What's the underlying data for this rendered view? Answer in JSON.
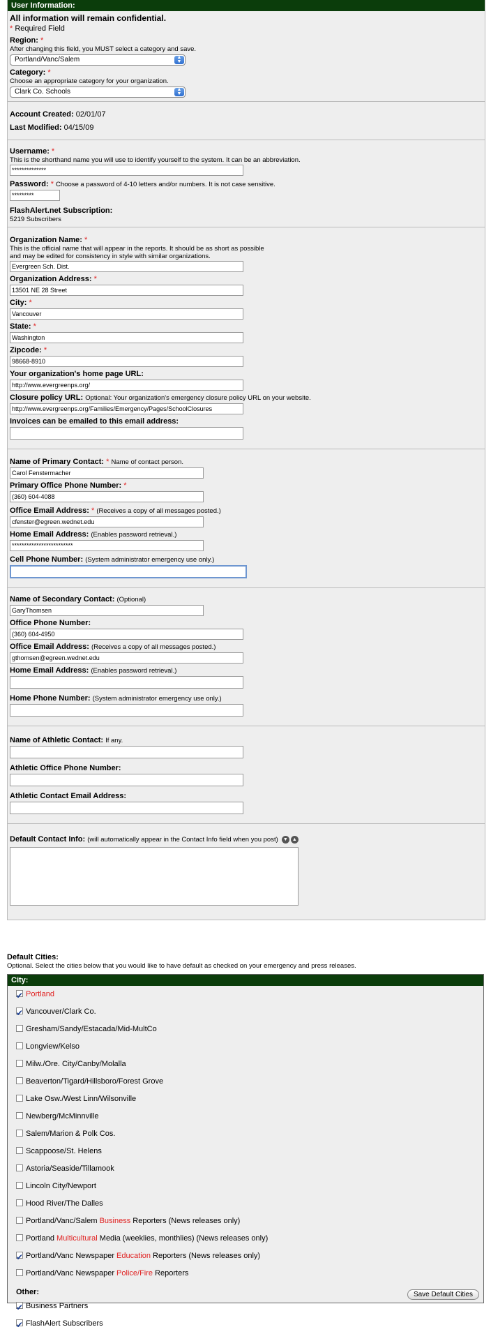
{
  "header": {
    "title": "User Information:"
  },
  "intro": {
    "confidential": "All information will remain confidential.",
    "required_mark": "*",
    "required_text": " Required Field"
  },
  "region": {
    "label": "Region:",
    "help": "After changing this field, you MUST select a category and save.",
    "value": "Portland/Vanc/Salem"
  },
  "category": {
    "label": "Category:",
    "help": "Choose an appropriate category for your organization.",
    "value": "Clark Co. Schools"
  },
  "account": {
    "created_label": "Account Created:",
    "created_value": "02/01/07",
    "modified_label": "Last Modified:",
    "modified_value": "04/15/09"
  },
  "login": {
    "username_label": "Username:",
    "username_help": "This is the shorthand name you will use to identify yourself to the system. It can be an abbreviation.",
    "username_value": "**************",
    "password_label": "Password:",
    "password_help": "Choose a password of 4-10 letters and/or numbers. It is not case sensitive.",
    "password_value": "*********",
    "sub_label": "FlashAlert.net Subscription:",
    "sub_value": "5219 Subscribers"
  },
  "org": {
    "name_label": "Organization Name:",
    "name_help1": "This is the official name that will appear in the reports. It should be as short as possible",
    "name_help2": " and may be edited for consistency in style with similar organizations.",
    "name_value": "Evergreen Sch. Dist.",
    "address_label": "Organization Address:",
    "address_value": "13501 NE 28 Street",
    "city_label": "City:",
    "city_value": "Vancouver",
    "state_label": "State:",
    "state_value": "Washington",
    "zip_label": "Zipcode:",
    "zip_value": "98668-8910",
    "home_label": "Your organization's home page URL:",
    "home_value": "http://www.evergreenps.org/",
    "closure_label": "Closure policy URL:",
    "closure_help": "Optional: Your organization's emergency closure policy URL on your website.",
    "closure_value": "http://www.evergreenps.org/Families/Emergency/Pages/SchoolClosures",
    "invoice_label": "Invoices can be emailed to this email address:",
    "invoice_value": ""
  },
  "primary": {
    "name_label": "Name of Primary Contact:",
    "name_help": "Name of contact person.",
    "name_value": "Carol Fenstermacher",
    "phone_label": "Primary Office Phone Number:",
    "phone_value": "(360) 604-4088",
    "email_label": "Office Email Address:",
    "email_help": "(Receives a copy of all messages posted.)",
    "email_value": "cfenster@egreen.wednet.edu",
    "home_email_label": "Home Email Address:",
    "home_email_help": "(Enables password retrieval.)",
    "home_email_value": "*************************",
    "cell_label": "Cell Phone Number:",
    "cell_help": "(System administrator emergency use only.)",
    "cell_value": ""
  },
  "secondary": {
    "name_label": "Name of Secondary Contact:",
    "name_help": "(Optional)",
    "name_value": "GaryThomsen",
    "phone_label": "Office Phone Number:",
    "phone_value": "(360) 604-4950",
    "email_label": "Office Email Address:",
    "email_help": "(Receives a copy of all messages posted.)",
    "email_value": "gthomsen@egreen.wednet.edu",
    "home_email_label": "Home Email Address:",
    "home_email_help": "(Enables password retrieval.)",
    "home_email_value": "",
    "home_phone_label": "Home Phone Number:",
    "home_phone_help": "(System administrator emergency use only.)",
    "home_phone_value": ""
  },
  "athletic": {
    "name_label": "Name of Athletic Contact:",
    "name_help": "If any.",
    "phone_label": "Athletic Office Phone Number:",
    "email_label": "Athletic Contact Email Address:"
  },
  "default_contact": {
    "label": "Default Contact Info:",
    "help": "(will automatically appear in the Contact Info field when you post)"
  },
  "default_cities": {
    "title": "Default Cities:",
    "help": "Optional. Select the cities below that you would like to have default as checked on your emergency and press releases.",
    "header": "City:",
    "cities": [
      {
        "pre": "",
        "hl": "Portland",
        "post": "",
        "checked": true
      },
      {
        "pre": "Vancouver/Clark Co.",
        "hl": "",
        "post": "",
        "checked": true
      },
      {
        "pre": "Gresham/Sandy/Estacada/Mid-MultCo",
        "hl": "",
        "post": "",
        "checked": false
      },
      {
        "pre": "Longview/Kelso",
        "hl": "",
        "post": "",
        "checked": false
      },
      {
        "pre": "Milw./Ore. City/Canby/Molalla",
        "hl": "",
        "post": "",
        "checked": false
      },
      {
        "pre": "Beaverton/Tigard/Hillsboro/Forest Grove",
        "hl": "",
        "post": "",
        "checked": false
      },
      {
        "pre": "Lake Osw./West Linn/Wilsonville",
        "hl": "",
        "post": "",
        "checked": false
      },
      {
        "pre": "Newberg/McMinnville",
        "hl": "",
        "post": "",
        "checked": false
      },
      {
        "pre": "Salem/Marion & Polk Cos.",
        "hl": "",
        "post": "",
        "checked": false
      },
      {
        "pre": "Scappoose/St. Helens",
        "hl": "",
        "post": "",
        "checked": false
      },
      {
        "pre": "Astoria/Seaside/Tillamook",
        "hl": "",
        "post": "",
        "checked": false
      },
      {
        "pre": "Lincoln City/Newport",
        "hl": "",
        "post": "",
        "checked": false
      },
      {
        "pre": "Hood River/The Dalles",
        "hl": "",
        "post": "",
        "checked": false
      },
      {
        "pre": "Portland/Vanc/Salem ",
        "hl": "Business",
        "post": " Reporters (News releases only)",
        "checked": false
      },
      {
        "pre": "Portland ",
        "hl": "Multicultural",
        "post": " Media (weeklies, monthlies) (News releases only)",
        "checked": false
      },
      {
        "pre": "Portland/Vanc Newspaper ",
        "hl": "Education",
        "post": " Reporters (News releases only)",
        "checked": true
      },
      {
        "pre": "Portland/Vanc Newspaper ",
        "hl": "Police/Fire",
        "post": " Reporters",
        "checked": false
      }
    ],
    "other_label": "Other:",
    "other": [
      {
        "pre": "Business Partners",
        "hl": "",
        "post": "",
        "checked": true
      },
      {
        "pre": "FlashAlert Subscribers",
        "hl": "",
        "post": "",
        "checked": true
      }
    ],
    "save_label": "Save Default Cities"
  },
  "colors": {
    "header_bg": "#0b3d0b",
    "required": "#e02020",
    "panel_bg": "#eeeeee"
  }
}
